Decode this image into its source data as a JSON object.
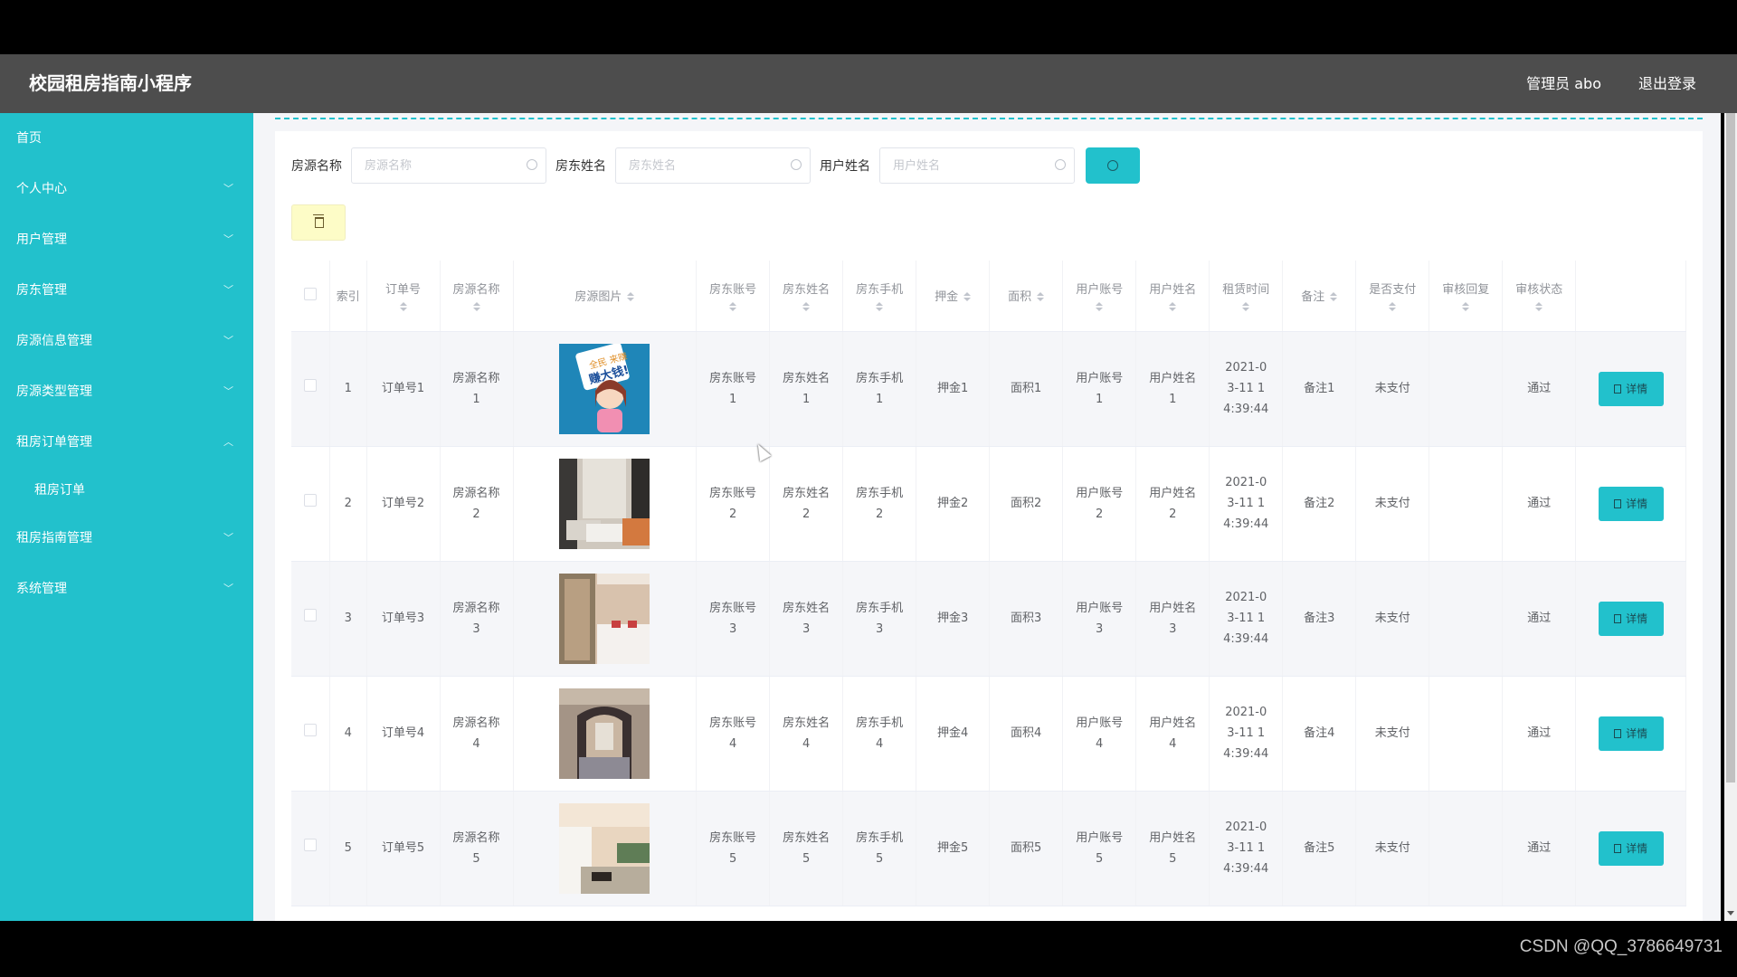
{
  "header": {
    "title": "校园租房指南小程序",
    "admin_label": "管理员 abo",
    "logout_label": "退出登录"
  },
  "sidebar": {
    "items": [
      {
        "label": "首页",
        "icon": "none"
      },
      {
        "label": "个人中心",
        "icon": "chevron-down-icon"
      },
      {
        "label": "用户管理",
        "icon": "chevron-down-icon"
      },
      {
        "label": "房东管理",
        "icon": "chevron-down-icon"
      },
      {
        "label": "房源信息管理",
        "icon": "chevron-down-icon"
      },
      {
        "label": "房源类型管理",
        "icon": "chevron-down-icon"
      },
      {
        "label": "租房订单管理",
        "icon": "chevron-up-icon",
        "expanded": true,
        "children": [
          {
            "label": "租房订单"
          }
        ]
      },
      {
        "label": "租房指南管理",
        "icon": "chevron-down-icon"
      },
      {
        "label": "系统管理",
        "icon": "chevron-down-icon"
      }
    ],
    "chevron_down": "﹀",
    "chevron_up": "︿"
  },
  "filters": [
    {
      "label": "房源名称",
      "placeholder": "房源名称",
      "value": ""
    },
    {
      "label": "房东姓名",
      "placeholder": "房东姓名",
      "value": ""
    },
    {
      "label": "用户姓名",
      "placeholder": "用户姓名",
      "value": ""
    }
  ],
  "buttons": {
    "search_icon": "search-icon",
    "delete_icon": "trash-icon",
    "detail_label": "详情"
  },
  "table": {
    "columns": [
      {
        "key": "select",
        "label": ""
      },
      {
        "key": "index",
        "label": "索引"
      },
      {
        "key": "order_no",
        "label": "订单号",
        "sortable": true
      },
      {
        "key": "house_name",
        "label": "房源名称",
        "sortable": true
      },
      {
        "key": "house_image",
        "label": "房源图片",
        "sortable": true
      },
      {
        "key": "landlord_account",
        "label": "房东账号",
        "sortable": true
      },
      {
        "key": "landlord_name",
        "label": "房东姓名",
        "sortable": true
      },
      {
        "key": "landlord_phone",
        "label": "房东手机",
        "sortable": true
      },
      {
        "key": "deposit",
        "label": "押金",
        "sortable": true
      },
      {
        "key": "area",
        "label": "面积",
        "sortable": true
      },
      {
        "key": "user_account",
        "label": "用户账号",
        "sortable": true
      },
      {
        "key": "user_name",
        "label": "用户姓名",
        "sortable": true
      },
      {
        "key": "rent_time",
        "label": "租赁时间",
        "sortable": true
      },
      {
        "key": "remark",
        "label": "备注",
        "sortable": true
      },
      {
        "key": "paid",
        "label": "是否支付",
        "sortable": true
      },
      {
        "key": "review_reply",
        "label": "审核回复",
        "sortable": true
      },
      {
        "key": "review_status",
        "label": "审核状态",
        "sortable": true
      },
      {
        "key": "actions",
        "label": ""
      }
    ],
    "rows": [
      {
        "index": "1",
        "order_no": "订单号1",
        "house_name": "房源名称1",
        "house_image": "cartoon-girl-sign",
        "landlord_account": "房东账号1",
        "landlord_name": "房东姓名1",
        "landlord_phone": "房东手机1",
        "deposit": "押金1",
        "area": "面积1",
        "user_account": "用户账号1",
        "user_name": "用户姓名1",
        "rent_time": "2021-03-11 14:39:44",
        "remark": "备注1",
        "paid": "未支付",
        "review_reply": "",
        "review_status": "通过"
      },
      {
        "index": "2",
        "order_no": "订单号2",
        "house_name": "房源名称2",
        "house_image": "living-room",
        "landlord_account": "房东账号2",
        "landlord_name": "房东姓名2",
        "landlord_phone": "房东手机2",
        "deposit": "押金2",
        "area": "面积2",
        "user_account": "用户账号2",
        "user_name": "用户姓名2",
        "rent_time": "2021-03-11 14:39:44",
        "remark": "备注2",
        "paid": "未支付",
        "review_reply": "",
        "review_status": "通过"
      },
      {
        "index": "3",
        "order_no": "订单号3",
        "house_name": "房源名称3",
        "house_image": "bedroom",
        "landlord_account": "房东账号3",
        "landlord_name": "房东姓名3",
        "landlord_phone": "房东手机3",
        "deposit": "押金3",
        "area": "面积3",
        "user_account": "用户账号3",
        "user_name": "用户姓名3",
        "rent_time": "2021-03-11 14:39:44",
        "remark": "备注3",
        "paid": "未支付",
        "review_reply": "",
        "review_status": "通过"
      },
      {
        "index": "4",
        "order_no": "订单号4",
        "house_name": "房源名称4",
        "house_image": "dining-hall",
        "landlord_account": "房东账号4",
        "landlord_name": "房东姓名4",
        "landlord_phone": "房东手机4",
        "deposit": "押金4",
        "area": "面积4",
        "user_account": "用户账号4",
        "user_name": "用户姓名4",
        "rent_time": "2021-03-11 14:39:44",
        "remark": "备注4",
        "paid": "未支付",
        "review_reply": "",
        "review_status": "通过"
      },
      {
        "index": "5",
        "order_no": "订单号5",
        "house_name": "房源名称5",
        "house_image": "lounge",
        "landlord_account": "房东账号5",
        "landlord_name": "房东姓名5",
        "landlord_phone": "房东手机5",
        "deposit": "押金5",
        "area": "面积5",
        "user_account": "用户账号5",
        "user_name": "用户姓名5",
        "rent_time": "2021-03-11 14:39:44",
        "remark": "备注5",
        "paid": "未支付",
        "review_reply": "",
        "review_status": "通过"
      }
    ]
  },
  "colors": {
    "accent": "#22c1cc",
    "header_bg": "#4d4d4d",
    "delete_bg": "#fdfcc7"
  },
  "watermark": "CSDN @QQ_3786649731"
}
